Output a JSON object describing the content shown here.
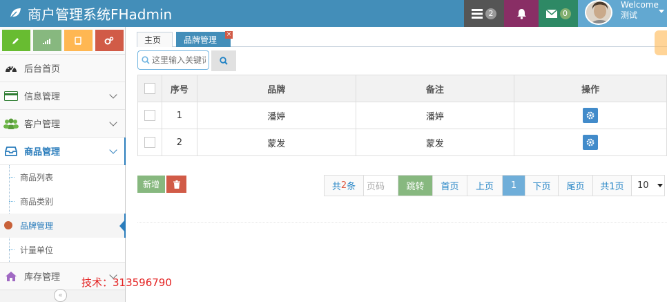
{
  "app": {
    "title": "商户管理系统FHadmin"
  },
  "navbar": {
    "tasks_count": "2",
    "messages_count": "0",
    "welcome": "Welcome",
    "username": "测试",
    "colors": {
      "bar": "#438eb9",
      "tasks": "#555555",
      "notifications": "#892e65",
      "messages": "#2e8965",
      "user": "#62a8d1"
    }
  },
  "sidebar": {
    "shortcuts": [
      {
        "icon": "pencil-icon",
        "color": "#68bc31"
      },
      {
        "icon": "signal-icon",
        "color": "#87b87f"
      },
      {
        "icon": "book-icon",
        "color": "#ffb752"
      },
      {
        "icon": "cogs-icon",
        "color": "#d15b47"
      }
    ],
    "items": [
      {
        "label": "后台首页",
        "icon": "dashboard-icon"
      },
      {
        "label": "信息管理",
        "icon": "credit-card-icon"
      },
      {
        "label": "客户管理",
        "icon": "users-icon"
      },
      {
        "label": "商品管理",
        "icon": "inbox-icon"
      },
      {
        "label": "库存管理",
        "icon": "home-icon"
      }
    ],
    "subitems": [
      {
        "label": "商品列表"
      },
      {
        "label": "商品类别"
      },
      {
        "label": "品牌管理"
      },
      {
        "label": "计量单位"
      }
    ],
    "toggle": "«"
  },
  "tabs": {
    "home": "主页",
    "brand": "品牌管理",
    "close": "×"
  },
  "search": {
    "placeholder": "这里输入关键词"
  },
  "table": {
    "columns": {
      "index": "序号",
      "brand": "品牌",
      "remark": "备注",
      "ops": "操作"
    },
    "rows": [
      {
        "index": "1",
        "brand": "潘婷",
        "remark": "潘婷"
      },
      {
        "index": "2",
        "brand": "蒙发",
        "remark": "蒙发"
      }
    ]
  },
  "actions": {
    "add": "新增"
  },
  "pager": {
    "count_prefix": "共",
    "count_num": "2",
    "count_suffix": "条",
    "page_placeholder": "页码",
    "jump": "跳转",
    "first": "首页",
    "prev": "上页",
    "current": "1",
    "next": "下页",
    "last": "尾页",
    "total": "共1页",
    "page_size": "10"
  },
  "watermark": {
    "tech": "技术：313596790"
  }
}
